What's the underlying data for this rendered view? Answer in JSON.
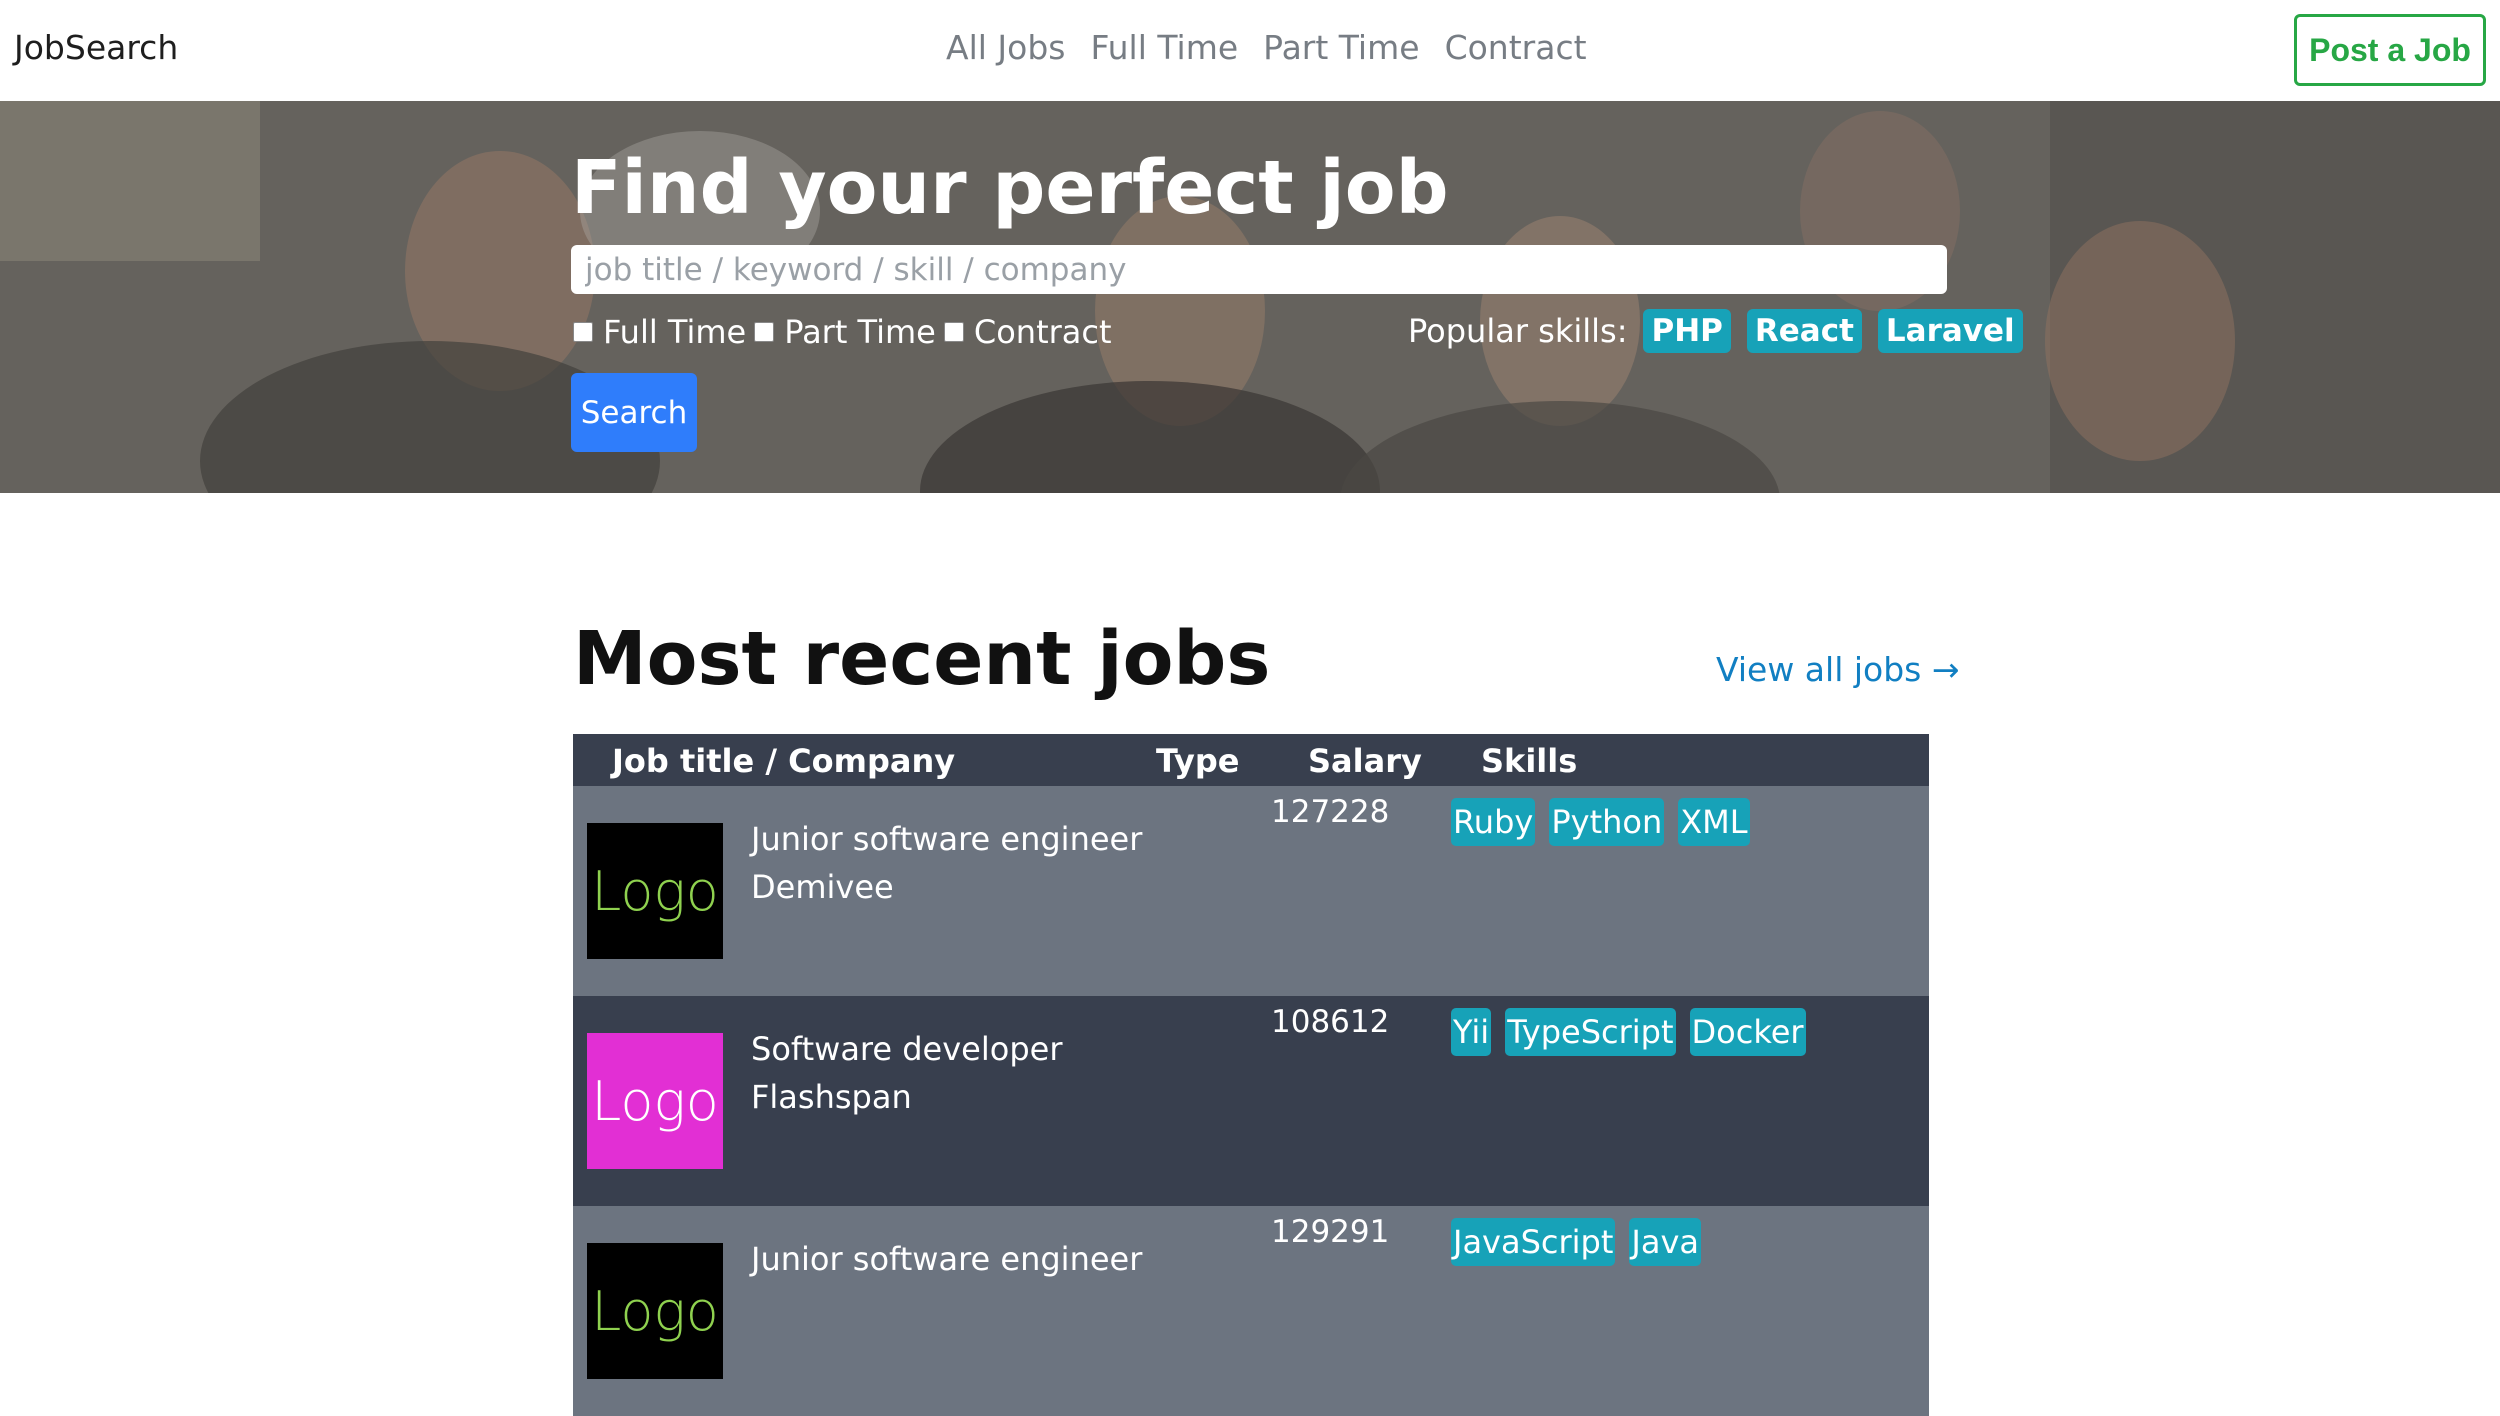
{
  "nav": {
    "brand": "JobSearch",
    "links": [
      "All Jobs",
      "Full Time",
      "Part Time",
      "Contract"
    ],
    "post_button": "Post a Job",
    "accent_color": "#27a745"
  },
  "hero": {
    "title": "Find your perfect job",
    "search_placeholder": "job title / keyword / skill / company",
    "type_filters": [
      "Full Time",
      "Part Time",
      "Contract"
    ],
    "popular_label": "Popular skills:",
    "popular_skills": [
      "PHP",
      "React",
      "Laravel"
    ],
    "search_button": "Search",
    "button_color": "#2f7dfb",
    "chip_color": "#17a2b8"
  },
  "recent": {
    "title": "Most recent jobs",
    "view_all": "View all jobs →",
    "columns": [
      "Job title / Company",
      "Type",
      "Salary",
      "Skills"
    ],
    "jobs": [
      {
        "logo_text": "Logo",
        "logo_bg": "#000000",
        "logo_color": "#8fd14f",
        "title": "Junior software engineer",
        "company": "Demivee",
        "type": "",
        "salary": "127228",
        "skills": [
          "Ruby",
          "Python",
          "XML"
        ]
      },
      {
        "logo_text": "Logo",
        "logo_bg": "#e22fd4",
        "logo_color": "#ffffff",
        "title": "Software developer",
        "company": "Flashspan",
        "type": "",
        "salary": "108612",
        "skills": [
          "Yii",
          "TypeScript",
          "Docker"
        ]
      },
      {
        "logo_text": "Logo",
        "logo_bg": "#000000",
        "logo_color": "#8fd14f",
        "title": "Junior software engineer",
        "company": "",
        "type": "",
        "salary": "129291",
        "skills": [
          "JavaScript",
          "Java"
        ]
      }
    ]
  }
}
